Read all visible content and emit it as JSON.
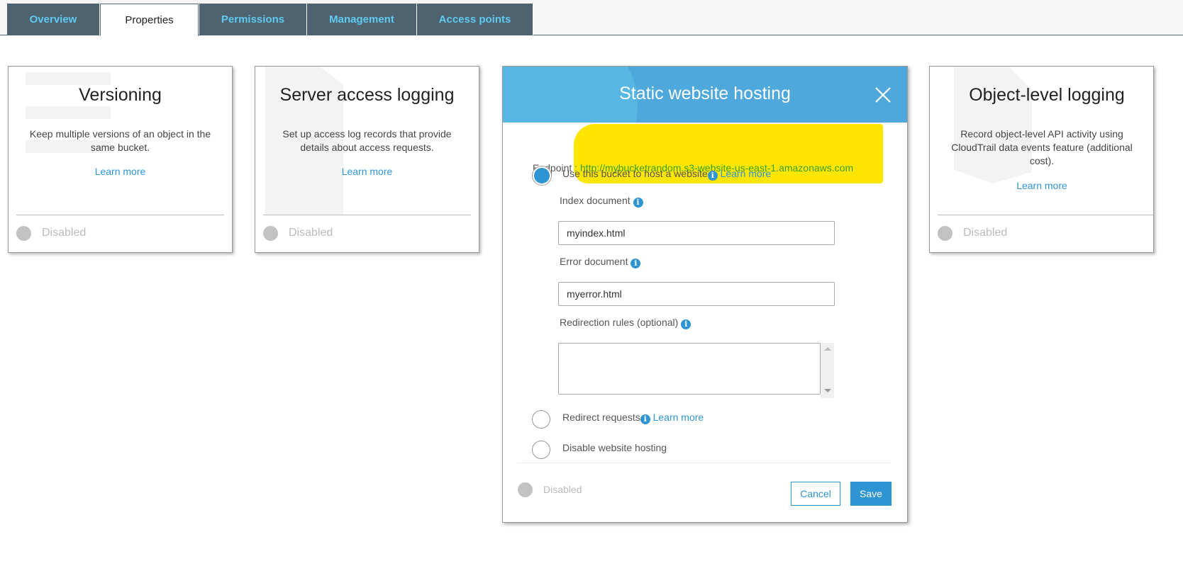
{
  "tabs": [
    {
      "label": "Overview"
    },
    {
      "label": "Properties",
      "active": true
    },
    {
      "label": "Permissions"
    },
    {
      "label": "Management"
    },
    {
      "label": "Access points"
    }
  ],
  "cards": [
    {
      "title": "Versioning",
      "desc": [
        "Keep multiple versions of an object in the",
        "same bucket."
      ],
      "learn": "Learn more",
      "status": "Disabled"
    },
    {
      "title": "Server access logging",
      "desc": [
        "Set up access log records that provide",
        "details about access requests."
      ],
      "learn": "Learn more",
      "status": "Disabled"
    },
    {
      "title": "Object-level logging",
      "desc": [
        "Record object-level API activity using",
        "CloudTrail data events feature (additional",
        "cost)."
      ],
      "learn": "Learn more",
      "status": "Disabled"
    }
  ],
  "modal": {
    "title": "Static website hosting",
    "endpoint_label": "Endpoint",
    "endpoint_sep": " : ",
    "endpoint_url": "http://mybucketrandom.s3-website-us-east-1.amazonaws.com",
    "option_host": "Use this bucket to host a website",
    "learn_more": "Learn more",
    "index_label": "Index document",
    "index_value": "myindex.html",
    "error_label": "Error document",
    "error_value": "myerror.html",
    "redirection_label": "Redirection rules (optional)",
    "redirection_value": "",
    "option_redirect": "Redirect requests",
    "option_disable": "Disable website hosting",
    "selected_option": "host",
    "status": "Disabled",
    "cancel": "Cancel",
    "save": "Save"
  },
  "colors": {
    "accent": "#2e95d3",
    "header": "#4ea8dc",
    "tab_bg": "#4f6270",
    "tab_text": "#5ecbf0",
    "highlight": "#ffe600",
    "endpoint": "#3aa02a"
  }
}
